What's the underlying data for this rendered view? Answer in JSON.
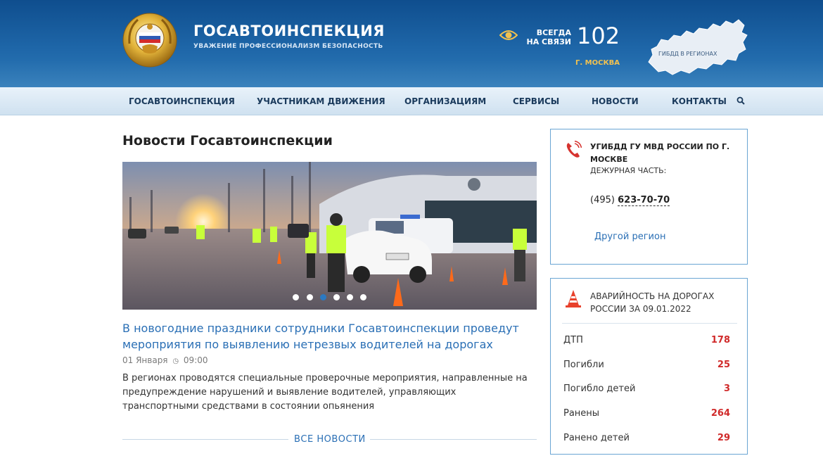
{
  "header": {
    "brand_title": "ГОСАВТОИНСПЕКЦИЯ",
    "brand_subtitle": "УВАЖЕНИЕ ПРОФЕССИОНАЛИЗМ БЕЗОПАСНОСТЬ",
    "always_line1": "ВСЕГДА",
    "always_line2": "НА СВЯЗИ",
    "hotline_number": "102",
    "city": "Г. МОСКВА",
    "map_label": "ГИБДД В РЕГИОНАХ",
    "icons": {
      "emblem": "emblem-icon",
      "eye": "eye-icon",
      "map": "russia-map-icon"
    }
  },
  "nav": {
    "items": [
      {
        "label": "ГОСАВТОИНСПЕКЦИЯ"
      },
      {
        "label": "УЧАСТНИКАМ ДВИЖЕНИЯ"
      },
      {
        "label": "ОРГАНИЗАЦИЯМ"
      },
      {
        "label": "СЕРВИСЫ"
      },
      {
        "label": "НОВОСТИ"
      },
      {
        "label": "КОНТАКТЫ"
      }
    ],
    "search_icon": "search-icon"
  },
  "main": {
    "section_title": "Новости Госавтоинспекции",
    "carousel": {
      "slide_count": 6,
      "active_index": 2
    },
    "news": {
      "title": "В новогодние праздники сотрудники Госавтоинспекции проведут мероприятия по выявлению нетрезвых водителей на дорогах",
      "date": "01 Января",
      "time": "09:00",
      "text": "В регионах проводятся специальные проверочные мероприятия, направленные на предупреждение нарушений и выявление водителей, управляющих транспортными средствами в состоянии опьянения"
    },
    "all_news_label": "ВСЕ НОВОСТИ"
  },
  "sidebar": {
    "contact": {
      "department": "УГИБДД ГУ МВД РОССИИ ПО Г. МОСКВЕ",
      "duty_label": "ДЕЖУРНАЯ ЧАСТЬ:",
      "phone_code": "(495)",
      "phone_number": "623-70-70",
      "other_region": "Другой регион"
    },
    "accidents": {
      "title": "АВАРИЙНОСТЬ НА ДОРОГАХ РОССИИ ЗА 09.01.2022",
      "stats": [
        {
          "label": "ДТП",
          "value": "178"
        },
        {
          "label": "Погибли",
          "value": "25"
        },
        {
          "label": "Погибло детей",
          "value": "3"
        },
        {
          "label": "Ранены",
          "value": "264"
        },
        {
          "label": "Ранено детей",
          "value": "29"
        }
      ]
    }
  },
  "colors": {
    "header_dark": "#0f4e8e",
    "accent_link": "#2a6fb5",
    "accent_red": "#d02a2a",
    "accent_gold": "#f2c14e",
    "card_border": "#6aa5d3"
  }
}
